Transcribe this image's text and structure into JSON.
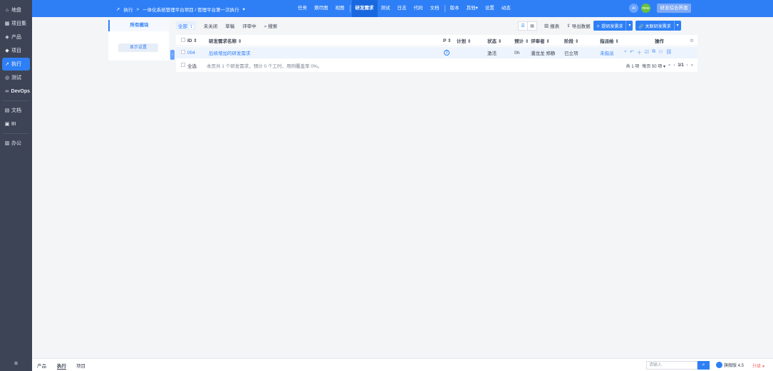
{
  "sidebar": {
    "items": [
      {
        "icon": "⌂",
        "label": "地盘"
      },
      {
        "icon": "▦",
        "label": "项目集"
      },
      {
        "icon": "◈",
        "label": "产品"
      },
      {
        "icon": "◆",
        "label": "项目"
      },
      {
        "icon": "➚",
        "label": "执行"
      },
      {
        "icon": "◎",
        "label": "测试"
      },
      {
        "icon": "∞",
        "label": "DevOps"
      },
      {
        "icon": "▤",
        "label": "文档"
      },
      {
        "icon": "▣",
        "label": "BI"
      },
      {
        "icon": "▥",
        "label": "办公"
      }
    ],
    "bottom_icon": "≡"
  },
  "topbar": {
    "breadcrumb_icon": "➚",
    "breadcrumb_root": "执行",
    "breadcrumb_sep": ">",
    "breadcrumb_path": "一体化系统管理平台项目 / 管理平台第一次执行",
    "nav": [
      "任务",
      "燃尽图",
      "视图",
      "研发需求",
      "测试",
      "日志",
      "代码",
      "文档",
      "版本",
      "其他",
      "设置",
      "动态"
    ],
    "active_nav": "研发需求",
    "ai_label": "AI",
    "avatar_text": "mine",
    "ui_switch": "研发综合界面"
  },
  "left_panel": {
    "title": "所有模块",
    "button": "显示设置"
  },
  "filters": {
    "all": "全部",
    "all_count": "1",
    "unclosed": "未关闭",
    "draft": "草稿",
    "reviewing": "评审中",
    "search": "搜索"
  },
  "actions": {
    "report": "报表",
    "export": "导出数据",
    "create": "提研发需求",
    "link": "关联研发需求"
  },
  "table": {
    "headers": {
      "id": "ID",
      "name": "研发需求名称",
      "p": "P",
      "plan": "计划",
      "status": "状态",
      "estimate": "预计",
      "reviewer": "评审者",
      "stage": "阶段",
      "assignee": "指派给",
      "ops": "操作"
    },
    "rows": [
      {
        "id": "004",
        "name": "后续增加的研发需求",
        "p": "3",
        "plan": "",
        "status": "激活",
        "estimate": "0h",
        "reviewer": "潘龙龙 郑静",
        "stage": "已立项",
        "assignee": "未指派"
      }
    ],
    "footer": {
      "select_all": "全选",
      "summary": "本页共 1 个研发需求，预计 0 个工时，用例覆盖率 0%。",
      "total": "共 1 项",
      "per_page": "每页 50 项",
      "page": "1/1"
    }
  },
  "statusbar": {
    "tabs": [
      "产品",
      "执行",
      "项目"
    ],
    "active": "执行",
    "search_placeholder": "请输入",
    "version": "旗舰版 4.5",
    "upgrade": "升级"
  }
}
